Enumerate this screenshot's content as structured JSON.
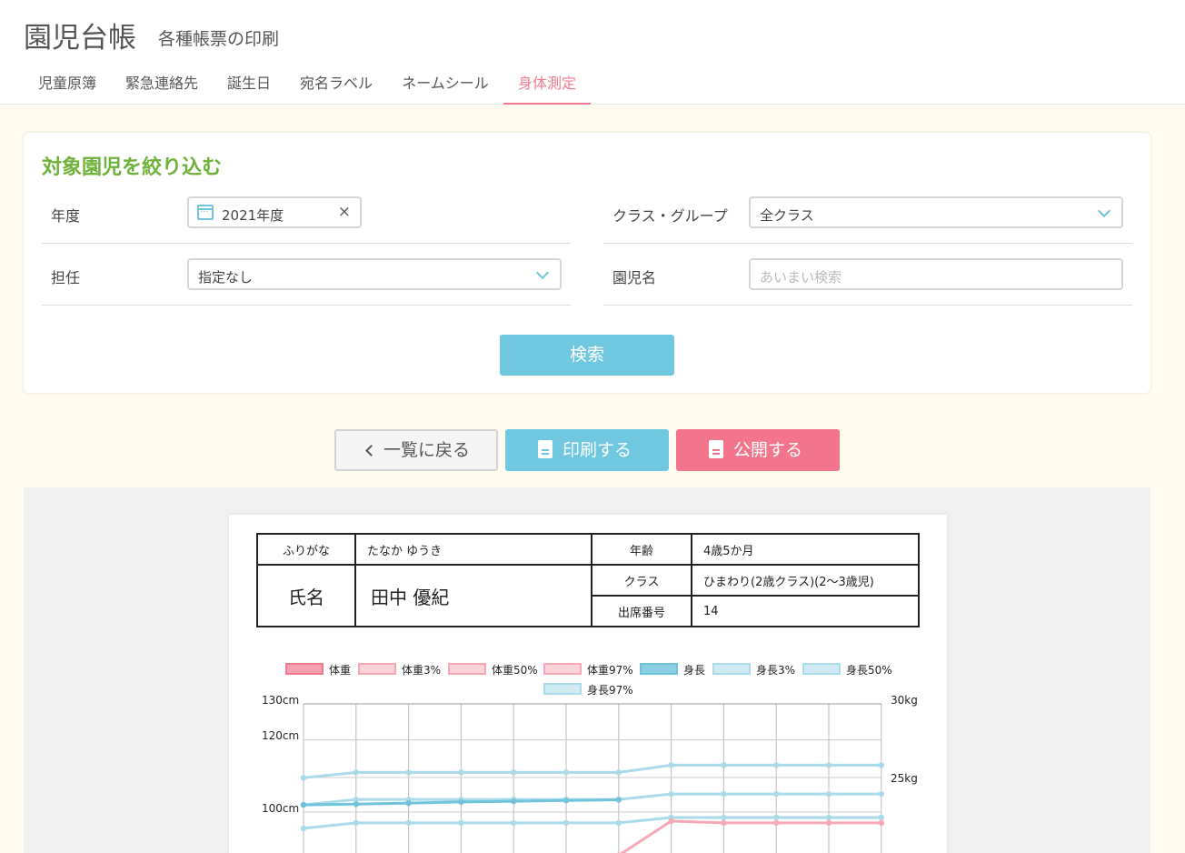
{
  "header": {
    "title": "園児台帳",
    "subtitle": "各種帳票の印刷",
    "tabs": [
      {
        "label": "児童原簿"
      },
      {
        "label": "緊急連絡先"
      },
      {
        "label": "誕生日"
      },
      {
        "label": "宛名ラベル"
      },
      {
        "label": "ネームシール"
      },
      {
        "label": "身体測定"
      }
    ],
    "active_tab": "身体測定"
  },
  "filter": {
    "title": "対象園児を絞り込む",
    "year_label": "年度",
    "year_value": "2021年度",
    "class_label": "クラス・グループ",
    "class_value": "全クラス",
    "teacher_label": "担任",
    "teacher_value": "指定なし",
    "child_label": "園児名",
    "child_placeholder": "あいまい検索",
    "search_button": "検索"
  },
  "actions": {
    "back": "一覧に戻る",
    "print": "印刷する",
    "publish": "公開する"
  },
  "colors": {
    "accent_pink": "#f07b8f",
    "accent_blue": "#6fc8e0",
    "accent_green": "#6fb23a"
  },
  "report": {
    "furigana_label": "ふりがな",
    "furigana_value": "たなか ゆうき",
    "age_label": "年齢",
    "age_value": "4歳5か月",
    "name_label": "氏名",
    "name_value": "田中 優紀",
    "class_label": "クラス",
    "class_value": "ひまわり(2歳クラス)(2〜3歳児)",
    "seat_label": "出席番号",
    "seat_value": "14"
  },
  "chart_data": {
    "type": "line",
    "legend": [
      {
        "name": "体重",
        "color": "#f07b8f",
        "fill": "#f7a0ae"
      },
      {
        "name": "体重3%",
        "color": "#f7a8b6",
        "fill": "#fcd3da"
      },
      {
        "name": "体重50%",
        "color": "#f7a8b6",
        "fill": "#fcd3da"
      },
      {
        "name": "体重97%",
        "color": "#f7a8b6",
        "fill": "#fcd3da"
      },
      {
        "name": "身長",
        "color": "#6fc3dc",
        "fill": "#8ccfe3"
      },
      {
        "name": "身長3%",
        "color": "#a9dbea",
        "fill": "#cfeaf3"
      },
      {
        "name": "身長50%",
        "color": "#a9dbea",
        "fill": "#cfeaf3"
      },
      {
        "name": "身長97%",
        "color": "#a9dbea",
        "fill": "#cfeaf3"
      }
    ],
    "left_axis_labels": [
      "130cm",
      "120cm",
      "100cm"
    ],
    "right_axis_labels": [
      "30kg",
      "25kg"
    ],
    "series": [
      {
        "name": "身長97%",
        "values": [
          109.5,
          111,
          111,
          111,
          111,
          111,
          111,
          113,
          113,
          113,
          113,
          113
        ]
      },
      {
        "name": "身長50%",
        "values": [
          102,
          103.5,
          103.5,
          103.5,
          103.5,
          103.5,
          103.5,
          105,
          105,
          105,
          105,
          105
        ]
      },
      {
        "name": "身長3%",
        "values": [
          95.5,
          97,
          97,
          97,
          97,
          97,
          97,
          98.5,
          98.5,
          98.5,
          98.5,
          98.5
        ]
      },
      {
        "name": "身長",
        "values": [
          102,
          102.2,
          102.5,
          102.8,
          103,
          103.2,
          103.4
        ]
      },
      {
        "name": "体重97%",
        "values": [
          null,
          null,
          null,
          null,
          null,
          null,
          88,
          97.5,
          97,
          97,
          97,
          97
        ]
      }
    ]
  }
}
